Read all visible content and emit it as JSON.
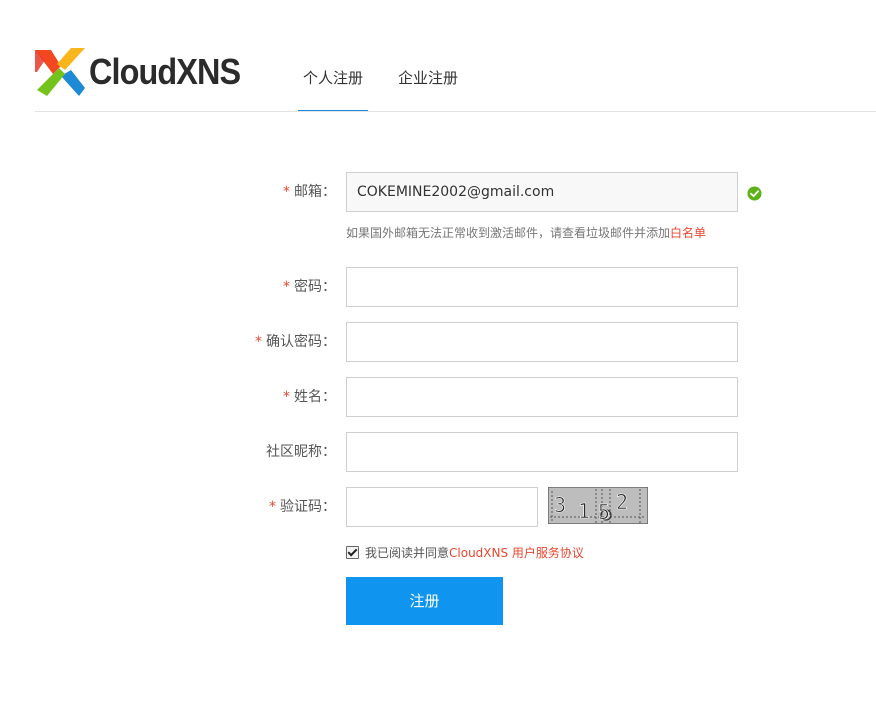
{
  "brand": {
    "name": "CloudXNS"
  },
  "tabs": [
    {
      "label": "个人注册",
      "active": true
    },
    {
      "label": "企业注册",
      "active": false
    }
  ],
  "form": {
    "required_mark": "*",
    "email": {
      "label": "邮箱：",
      "value": "COKEMINE2002@gmail.com",
      "valid": true
    },
    "email_hint": {
      "text": "如果国外邮箱无法正常收到激活邮件，请查看垃圾邮件并添加",
      "link": "白名单"
    },
    "password": {
      "label": "密码：",
      "value": ""
    },
    "confirm_password": {
      "label": "确认密码：",
      "value": ""
    },
    "name": {
      "label": "姓名：",
      "value": ""
    },
    "nickname": {
      "label": "社区昵称：",
      "value": ""
    },
    "captcha": {
      "label": "验证码：",
      "value": "",
      "image_text": "3152"
    },
    "agreement": {
      "checked": true,
      "text": "我已阅读并同意",
      "link": "CloudXNS 用户服务协议"
    },
    "submit_label": "注册"
  },
  "colors": {
    "accent": "#0f95ef",
    "required": "#e8472f",
    "valid": "#5bb318",
    "tab_underline": "#1e8ae0"
  }
}
